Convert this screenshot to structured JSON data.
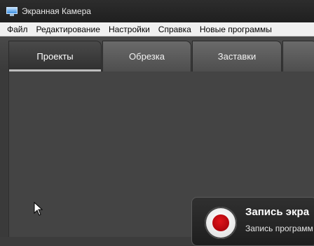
{
  "window": {
    "title": "Экранная Камера"
  },
  "menu": {
    "items": [
      "Файл",
      "Редактирование",
      "Настройки",
      "Справка",
      "Новые программы"
    ]
  },
  "tabs": [
    "Проекты",
    "Обрезка",
    "Заставки"
  ],
  "record_card": {
    "title": "Запись экра",
    "subtitle": "Запись программ"
  }
}
